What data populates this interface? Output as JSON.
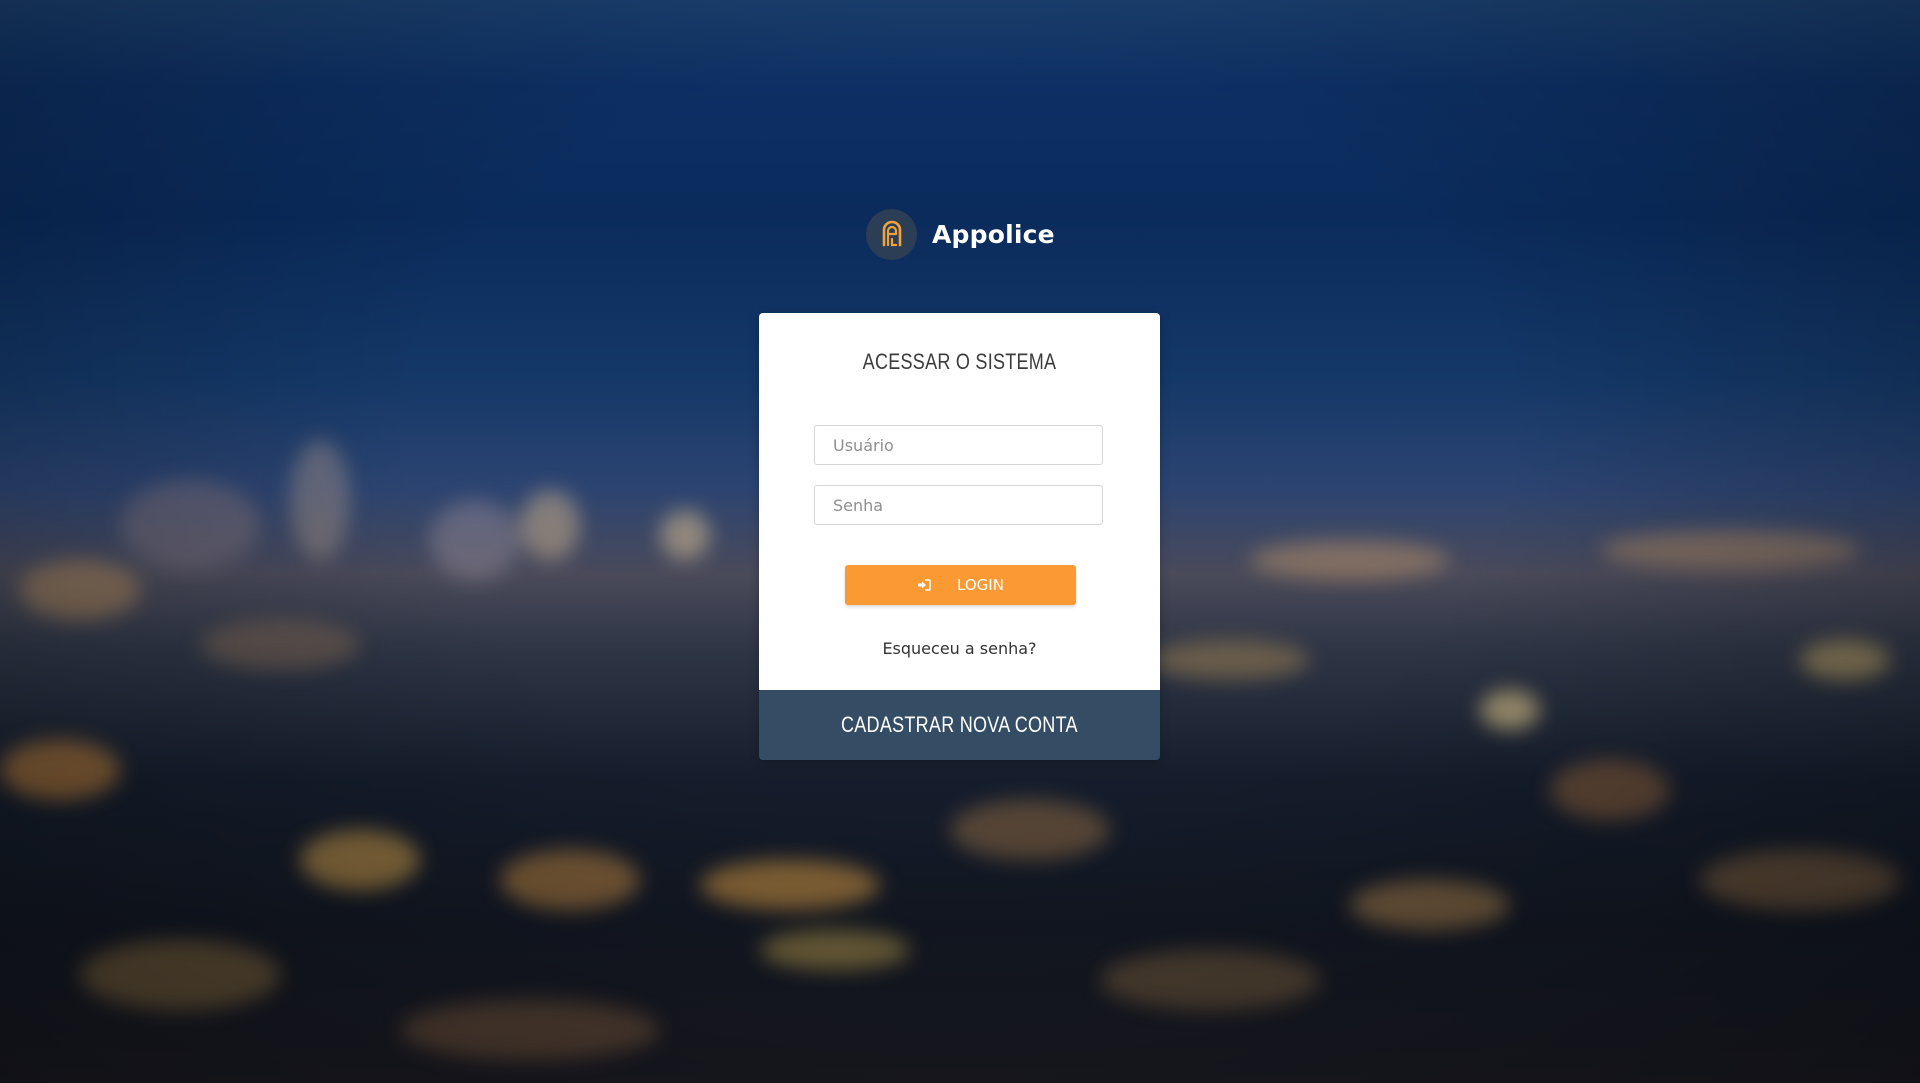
{
  "brand": {
    "name": "Appolice",
    "logo_icon": "appolice-logo-icon",
    "accent_color": "#fb9a32"
  },
  "login_card": {
    "title": "ACESSAR O SISTEMA",
    "username": {
      "placeholder": "Usuário",
      "value": ""
    },
    "password": {
      "placeholder": "Senha",
      "value": ""
    },
    "login_button": {
      "label": "LOGIN",
      "icon": "sign-in-icon",
      "color": "#fb9a32"
    },
    "forgot_link": "Esqueceu a senha?"
  },
  "register": {
    "label": "CADASTRAR NOVA CONTA",
    "color": "#344d64"
  }
}
